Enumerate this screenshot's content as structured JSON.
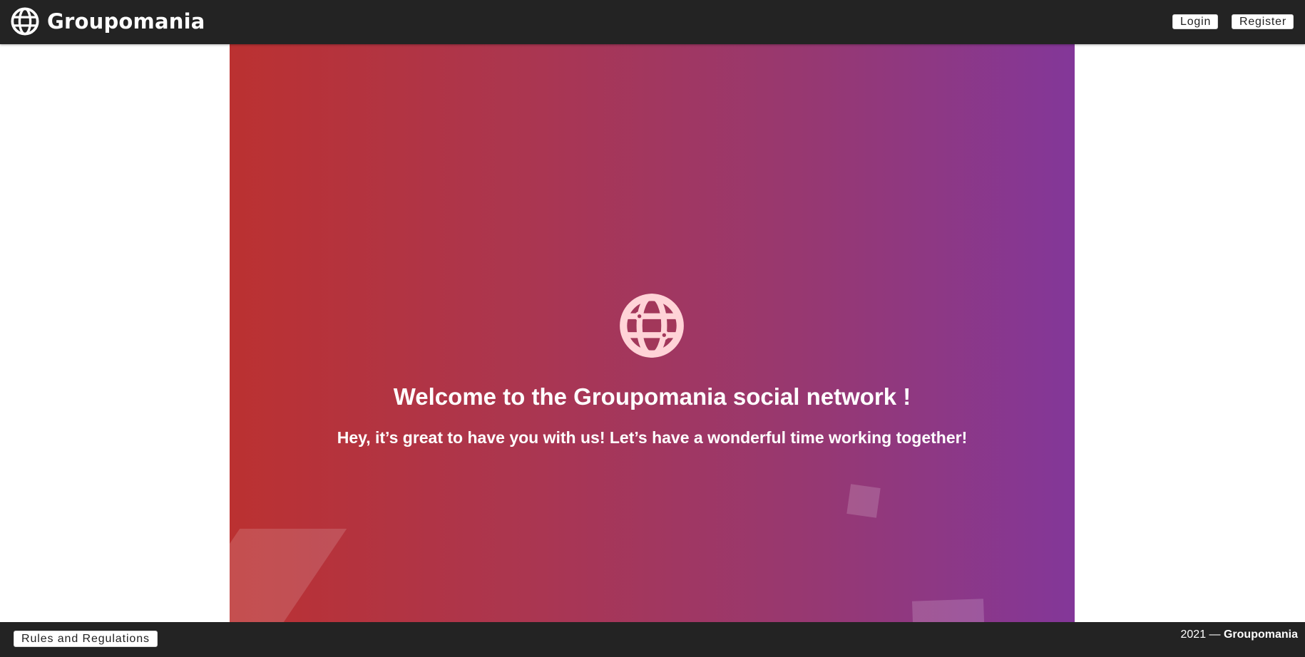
{
  "header": {
    "brand": "Groupomania",
    "login_label": "Login",
    "register_label": "Register"
  },
  "hero": {
    "title": "Welcome to the Groupomania social network !",
    "subtitle": "Hey, it’s great to have you with us! Let’s have a wonderful time working together!",
    "gradient_colors": [
      "#bb3131",
      "#833799"
    ],
    "icon": "globe-icon"
  },
  "footer": {
    "rules_label": "Rules and Regulations",
    "copyright_prefix": "2021 — ",
    "copyright_brand": "Groupomania"
  },
  "theme": {
    "bar_color": "#232323",
    "icon_tint": "#ffd3d7"
  }
}
